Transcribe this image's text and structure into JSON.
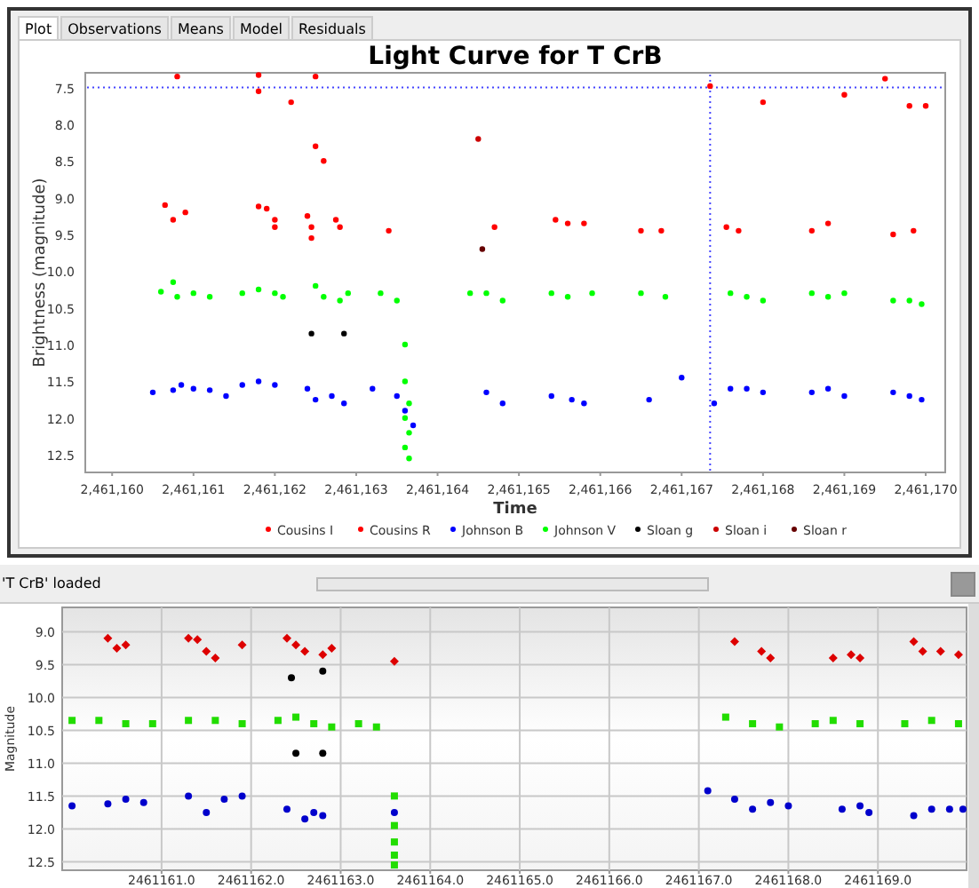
{
  "window": {
    "tabs": [
      {
        "label": "Plot",
        "selected": true
      },
      {
        "label": "Observations",
        "selected": false
      },
      {
        "label": "Means",
        "selected": false
      },
      {
        "label": "Model",
        "selected": false
      },
      {
        "label": "Residuals",
        "selected": false
      }
    ]
  },
  "light_curve": {
    "chart_data": {
      "type": "scatter",
      "title": "Light Curve for T CrB",
      "xlabel": "Time",
      "ylabel": "Brightness (magnitude)",
      "xlim": [
        2461159.67,
        2461170.24
      ],
      "ylim": [
        12.74,
        7.3
      ],
      "xticks": [
        {
          "value": 2461160,
          "label": "2,461,160"
        },
        {
          "value": 2461161,
          "label": "2,461,161"
        },
        {
          "value": 2461162,
          "label": "2,461,162"
        },
        {
          "value": 2461163,
          "label": "2,461,163"
        },
        {
          "value": 2461164,
          "label": "2,461,164"
        },
        {
          "value": 2461165,
          "label": "2,461,165"
        },
        {
          "value": 2461166,
          "label": "2,461,166"
        },
        {
          "value": 2461167,
          "label": "2,461,167"
        },
        {
          "value": 2461168,
          "label": "2,461,168"
        },
        {
          "value": 2461169,
          "label": "2,461,169"
        },
        {
          "value": 2461170,
          "label": "2,461,170"
        }
      ],
      "yticks": [
        {
          "value": 7.5,
          "label": "7.5"
        },
        {
          "value": 8,
          "label": "8.0"
        },
        {
          "value": 8.5,
          "label": "8.5"
        },
        {
          "value": 9,
          "label": "9.0"
        },
        {
          "value": 9.5,
          "label": "9.5"
        },
        {
          "value": 10,
          "label": "10.0"
        },
        {
          "value": 10.5,
          "label": "10.5"
        },
        {
          "value": 11,
          "label": "11.0"
        },
        {
          "value": 11.5,
          "label": "11.5"
        },
        {
          "value": 12,
          "label": "12.0"
        },
        {
          "value": 12.5,
          "label": "12.5"
        }
      ],
      "legend": true,
      "ref_lines": [
        {
          "axis": "x",
          "value": 2461167.35
        },
        {
          "axis": "y",
          "value": 7.5
        }
      ],
      "series": [
        {
          "name": "Cousins I",
          "color": "#ff0000",
          "marker": "circle",
          "x": [
            2461160.8,
            2461161.8,
            2461162.5,
            2461167.35,
            2461169.5
          ],
          "values": [
            7.35,
            7.33,
            7.35,
            7.48,
            7.38
          ]
        },
        {
          "name": "Cousins R",
          "color": "#ff0000",
          "marker": "circle",
          "x": [
            2461161.8,
            2461162.2,
            2461160.65,
            2461160.9,
            2461160.75,
            2461161.8,
            2461161.9,
            2461162.0,
            2461162.0,
            2461162.4,
            2461162.45,
            2461162.45,
            2461162.75,
            2461162.8,
            2461162.6,
            2461162.5,
            2461163.4,
            2461164.7,
            2461165.45,
            2461165.6,
            2461165.8,
            2461166.5,
            2461166.75,
            2461167.55,
            2461167.7,
            2461168.6,
            2461168.8,
            2461169.6,
            2461169.85,
            2461168.0,
            2461169.8,
            2461170.0,
            2461169.0
          ],
          "values": [
            7.55,
            7.7,
            9.1,
            9.2,
            9.3,
            9.12,
            9.15,
            9.3,
            9.4,
            9.25,
            9.4,
            9.55,
            9.3,
            9.4,
            8.5,
            8.3,
            9.45,
            9.4,
            9.3,
            9.35,
            9.35,
            9.45,
            9.45,
            9.4,
            9.45,
            9.45,
            9.35,
            9.5,
            9.45,
            7.7,
            7.75,
            7.75,
            7.6
          ]
        },
        {
          "name": "Johnson B",
          "color": "#0000ff",
          "marker": "circle",
          "x": [
            2461160.5,
            2461160.75,
            2461160.85,
            2461161.0,
            2461161.2,
            2461161.4,
            2461161.6,
            2461161.8,
            2461162.0,
            2461162.4,
            2461162.5,
            2461162.7,
            2461162.85,
            2461163.2,
            2461163.5,
            2461163.6,
            2461163.7,
            2461164.6,
            2461164.8,
            2461165.4,
            2461165.65,
            2461165.8,
            2461166.6,
            2461167.0,
            2461167.4,
            2461167.6,
            2461167.8,
            2461168.0,
            2461168.6,
            2461168.8,
            2461169.0,
            2461169.6,
            2461169.8,
            2461169.95
          ],
          "values": [
            11.65,
            11.62,
            11.55,
            11.6,
            11.62,
            11.7,
            11.55,
            11.5,
            11.55,
            11.6,
            11.75,
            11.7,
            11.8,
            11.6,
            11.7,
            11.9,
            12.1,
            11.65,
            11.8,
            11.7,
            11.75,
            11.8,
            11.75,
            11.45,
            11.8,
            11.6,
            11.6,
            11.65,
            11.65,
            11.6,
            11.7,
            11.65,
            11.7,
            11.75
          ]
        },
        {
          "name": "Johnson V",
          "color": "#00ff00",
          "marker": "circle",
          "x": [
            2461160.6,
            2461160.75,
            2461160.8,
            2461161.0,
            2461161.2,
            2461161.6,
            2461161.8,
            2461162.0,
            2461162.1,
            2461162.5,
            2461162.6,
            2461162.8,
            2461162.9,
            2461163.3,
            2461163.5,
            2461163.6,
            2461163.6,
            2461163.65,
            2461163.6,
            2461163.65,
            2461163.6,
            2461163.65,
            2461164.4,
            2461164.6,
            2461164.8,
            2461165.4,
            2461165.6,
            2461165.9,
            2461166.5,
            2461166.8,
            2461167.6,
            2461167.8,
            2461168.0,
            2461168.6,
            2461168.8,
            2461169.0,
            2461169.6,
            2461169.8,
            2461169.95
          ],
          "values": [
            10.28,
            10.15,
            10.35,
            10.3,
            10.35,
            10.3,
            10.25,
            10.3,
            10.35,
            10.2,
            10.35,
            10.4,
            10.3,
            10.3,
            10.4,
            11.0,
            11.5,
            11.8,
            12.0,
            12.2,
            12.4,
            12.55,
            10.3,
            10.3,
            10.4,
            10.3,
            10.35,
            10.3,
            10.3,
            10.35,
            10.3,
            10.35,
            10.4,
            10.3,
            10.35,
            10.3,
            10.4,
            10.4,
            10.45
          ]
        },
        {
          "name": "Sloan g",
          "color": "#000000",
          "marker": "circle",
          "x": [
            2461162.45,
            2461162.85
          ],
          "values": [
            10.85,
            10.85
          ]
        },
        {
          "name": "Sloan i",
          "color": "#cc0000",
          "marker": "circle",
          "x": [
            2461164.5
          ],
          "values": [
            8.2
          ]
        },
        {
          "name": "Sloan r",
          "color": "#660000",
          "marker": "circle",
          "x": [
            2461164.55
          ],
          "values": [
            9.7
          ]
        }
      ]
    }
  },
  "status_bar": {
    "message": "'T CrB' loaded"
  },
  "magnitude_plot": {
    "chart_data": {
      "type": "scatter",
      "grid": true,
      "ylabel": "Magnitude",
      "xlim": [
        2461159.89,
        2461169.99
      ],
      "ylim": [
        12.63,
        8.63
      ],
      "xticks": [
        {
          "value": 2461161,
          "label": "2461161.0"
        },
        {
          "value": 2461162,
          "label": "2461162.0"
        },
        {
          "value": 2461163,
          "label": "2461163.0"
        },
        {
          "value": 2461164,
          "label": "2461164.0"
        },
        {
          "value": 2461165,
          "label": "2461165.0"
        },
        {
          "value": 2461166,
          "label": "2461166.0"
        },
        {
          "value": 2461167,
          "label": "2461167.0"
        },
        {
          "value": 2461168,
          "label": "2461168.0"
        },
        {
          "value": 2461169,
          "label": "2461169.0"
        }
      ],
      "yticks": [
        {
          "value": 9,
          "label": "9.0"
        },
        {
          "value": 9.5,
          "label": "9.5"
        },
        {
          "value": 10,
          "label": "10.0"
        },
        {
          "value": 10.5,
          "label": "10.5"
        },
        {
          "value": 11,
          "label": "11.0"
        },
        {
          "value": 11.5,
          "label": "11.5"
        },
        {
          "value": 12,
          "label": "12.0"
        },
        {
          "value": 12.5,
          "label": "12.5"
        }
      ],
      "series": [
        {
          "color": "#dd0000",
          "marker": "diamond",
          "x": [
            2461160.4,
            2461160.5,
            2461160.6,
            2461161.3,
            2461161.4,
            2461161.5,
            2461161.6,
            2461161.9,
            2461162.4,
            2461162.5,
            2461162.6,
            2461162.8,
            2461162.9,
            2461163.6,
            2461167.4,
            2461167.7,
            2461167.8,
            2461168.5,
            2461168.7,
            2461168.8,
            2461169.4,
            2461169.5,
            2461169.7,
            2461169.9
          ],
          "values": [
            9.1,
            9.25,
            9.2,
            9.1,
            9.12,
            9.3,
            9.4,
            9.2,
            9.1,
            9.2,
            9.3,
            9.35,
            9.25,
            9.45,
            9.15,
            9.3,
            9.4,
            9.4,
            9.35,
            9.4,
            9.15,
            9.3,
            9.3,
            9.35
          ]
        },
        {
          "color": "#000000",
          "marker": "circle",
          "x": [
            2461162.45,
            2461162.8,
            2461162.5,
            2461162.8
          ],
          "values": [
            9.7,
            9.6,
            10.85,
            10.85
          ]
        },
        {
          "color": "#22dd00",
          "marker": "square",
          "x": [
            2461160.0,
            2461160.3,
            2461160.6,
            2461160.9,
            2461161.3,
            2461161.6,
            2461161.9,
            2461162.3,
            2461162.5,
            2461162.7,
            2461162.9,
            2461163.2,
            2461163.4,
            2461163.6,
            2461163.6,
            2461163.6,
            2461163.6,
            2461163.6,
            2461167.3,
            2461167.6,
            2461167.9,
            2461168.3,
            2461168.5,
            2461168.8,
            2461169.3,
            2461169.6,
            2461169.9
          ],
          "values": [
            10.35,
            10.35,
            10.4,
            10.4,
            10.35,
            10.35,
            10.4,
            10.35,
            10.3,
            10.4,
            10.45,
            10.4,
            10.45,
            11.5,
            11.95,
            12.2,
            12.4,
            12.55,
            10.3,
            10.4,
            10.45,
            10.4,
            10.35,
            10.4,
            10.4,
            10.35,
            10.4
          ]
        },
        {
          "color": "#0000cc",
          "marker": "circle",
          "x": [
            2461160.0,
            2461160.4,
            2461160.6,
            2461160.8,
            2461161.3,
            2461161.5,
            2461161.7,
            2461161.9,
            2461162.4,
            2461162.6,
            2461162.7,
            2461162.8,
            2461163.6,
            2461167.1,
            2461167.4,
            2461167.6,
            2461167.8,
            2461168.0,
            2461168.6,
            2461168.8,
            2461168.9,
            2461169.4,
            2461169.6,
            2461169.8,
            2461169.95
          ],
          "values": [
            11.65,
            11.62,
            11.55,
            11.6,
            11.5,
            11.75,
            11.55,
            11.5,
            11.7,
            11.85,
            11.75,
            11.8,
            11.75,
            11.42,
            11.55,
            11.7,
            11.6,
            11.65,
            11.7,
            11.65,
            11.75,
            11.8,
            11.7,
            11.7,
            11.7
          ]
        }
      ]
    }
  }
}
